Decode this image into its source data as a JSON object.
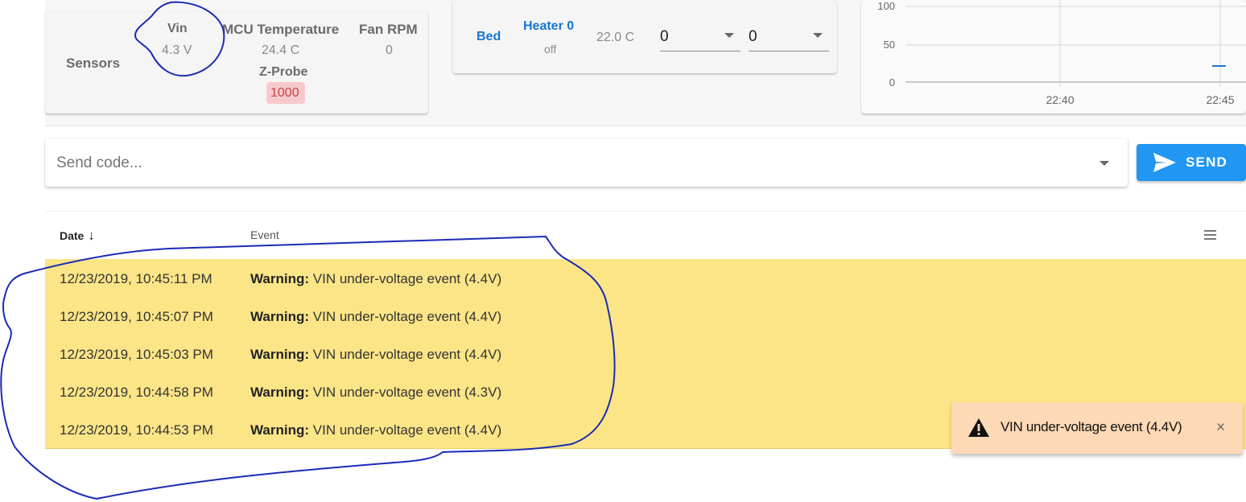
{
  "sensors": {
    "title": "Sensors",
    "vin_label": "Vin",
    "vin_value": "4.3 V",
    "mcu_label": "MCU Temperature",
    "mcu_value": "24.4 C",
    "fan_label": "Fan RPM",
    "fan_value": "0",
    "zprobe_label": "Z-Probe",
    "zprobe_value": "1000"
  },
  "heater": {
    "bed_label": "Bed",
    "heater_name": "Heater 0",
    "heater_state": "off",
    "current_temp": "22.0 C",
    "active_value": "0",
    "standby_value": "0"
  },
  "temp_chart": {
    "y_ticks": [
      "100",
      "50",
      "0"
    ],
    "x_ticks": [
      "22:40",
      "22:45"
    ]
  },
  "code_input": {
    "placeholder": "Send code...",
    "send_label": "SEND"
  },
  "events_table": {
    "col_date": "Date",
    "col_event": "Event",
    "rows": [
      {
        "date": "12/23/2019, 10:45:11 PM",
        "type": "Warning:",
        "message": "VIN under-voltage event (4.4V)"
      },
      {
        "date": "12/23/2019, 10:45:07 PM",
        "type": "Warning:",
        "message": "VIN under-voltage event (4.4V)"
      },
      {
        "date": "12/23/2019, 10:45:03 PM",
        "type": "Warning:",
        "message": "VIN under-voltage event (4.4V)"
      },
      {
        "date": "12/23/2019, 10:44:58 PM",
        "type": "Warning:",
        "message": "VIN under-voltage event (4.3V)"
      },
      {
        "date": "12/23/2019, 10:44:53 PM",
        "type": "Warning:",
        "message": "VIN under-voltage event (4.4V)"
      }
    ]
  },
  "toast": {
    "message": "VIN under-voltage event (4.4V)",
    "close": "×"
  },
  "colors": {
    "accent": "#2196f3",
    "warning_row": "#fce587",
    "toast_bg": "#fdd9b5",
    "annotation_ink": "#1a2bb5"
  }
}
